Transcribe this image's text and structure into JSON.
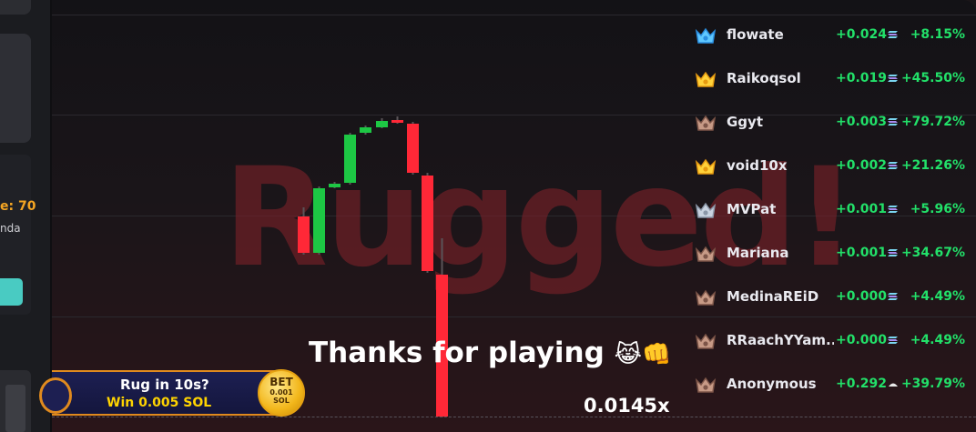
{
  "left_panel": {
    "count_fragment": "e: 70",
    "name_fragment": "nda"
  },
  "watermark": "Rugged!",
  "message": {
    "text": "Thanks for playing",
    "emoji": "😹👊"
  },
  "multiplier": "0.0145x",
  "bet_banner": {
    "rug_in": "Rug in 10s?",
    "win": "Win 0.005 SOL",
    "coin_title": "BET",
    "coin_amount": "0.001",
    "coin_unit": "SOL"
  },
  "colors": {
    "up": "#1dc744",
    "down": "#ff2837",
    "gain": "#22e069",
    "banner_border": "#e08a1e"
  },
  "leaderboard": [
    {
      "name": "flowate",
      "amount": "+0.024",
      "pct": "+8.15%",
      "badge": "diamond-badge-icon",
      "coin": "solana-icon"
    },
    {
      "name": "Raikoqsol",
      "amount": "+0.019",
      "pct": "+45.50%",
      "badge": "gold-crown-badge-icon",
      "coin": "solana-icon"
    },
    {
      "name": "Ggyt",
      "amount": "+0.003",
      "pct": "+79.72%",
      "badge": "bronze-badge-icon",
      "coin": "solana-icon"
    },
    {
      "name": "void10x",
      "amount": "+0.002",
      "pct": "+21.26%",
      "badge": "gold-crown-badge-icon",
      "coin": "solana-icon"
    },
    {
      "name": "MVPat",
      "amount": "+0.001",
      "pct": "+5.96%",
      "badge": "silver-badge-icon",
      "coin": "solana-icon"
    },
    {
      "name": "Mariana",
      "amount": "+0.001",
      "pct": "+34.67%",
      "badge": "bronze-badge-icon",
      "coin": "solana-icon"
    },
    {
      "name": "MedinaREiD",
      "amount": "+0.000",
      "pct": "+4.49%",
      "badge": "bronze-badge-icon",
      "coin": "solana-icon"
    },
    {
      "name": "RRaachYYam...",
      "amount": "+0.000",
      "pct": "+4.49%",
      "badge": "bronze-badge-icon",
      "coin": "solana-icon"
    },
    {
      "name": "Anonymous",
      "amount": "+0.292",
      "pct": "+39.79%",
      "badge": "bronze-badge-icon",
      "coin": "token-icon"
    }
  ]
}
